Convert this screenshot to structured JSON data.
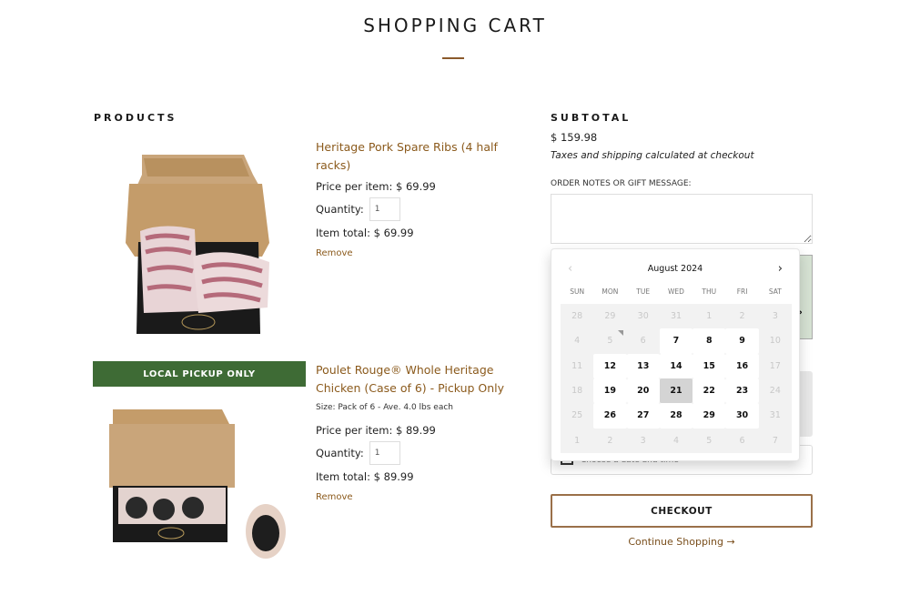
{
  "page": {
    "title": "SHOPPING CART"
  },
  "products_section": {
    "heading": "PRODUCTS",
    "items": [
      {
        "name": "Heritage Pork Spare Ribs (4 half racks)",
        "price_label": "Price per item: $ 69.99",
        "quantity_label": "Quantity:",
        "quantity": "1",
        "total_label": "Item total: $ 69.99",
        "remove_label": "Remove",
        "image": "pork-spare-ribs-box"
      },
      {
        "badge": "LOCAL PICKUP ONLY",
        "name": "Poulet Rouge® Whole Heritage Chicken (Case of 6) - Pickup Only",
        "variant": "Size: Pack of 6 - Ave. 4.0 lbs each",
        "price_label": "Price per item: $ 89.99",
        "quantity_label": "Quantity:",
        "quantity": "1",
        "total_label": "Item total: $ 89.99",
        "remove_label": "Remove",
        "image": "whole-chicken-case"
      }
    ]
  },
  "summary": {
    "heading": "SUBTOTAL",
    "subtotal": "$ 159.98",
    "tax_note": "Taxes and shipping calculated at checkout",
    "notes_label": "ORDER NOTES OR GIFT MESSAGE:",
    "notes_value": "",
    "date_field_text": "Choose a date and time",
    "checkout_label": "CHECKOUT",
    "continue_label": "Continue Shopping →"
  },
  "datepicker": {
    "month_label": "August 2024",
    "prev_icon": "‹",
    "next_icon": "›",
    "weekdays": [
      "SUN",
      "MON",
      "TUE",
      "WED",
      "THU",
      "FRI",
      "SAT"
    ],
    "weeks": [
      [
        "28",
        "29",
        "30",
        "31",
        "1",
        "2",
        "3"
      ],
      [
        "4",
        "5",
        "6",
        "7",
        "8",
        "9",
        "10"
      ],
      [
        "11",
        "12",
        "13",
        "14",
        "15",
        "16",
        "17"
      ],
      [
        "18",
        "19",
        "20",
        "21",
        "22",
        "23",
        "24"
      ],
      [
        "25",
        "26",
        "27",
        "28",
        "29",
        "30",
        "31"
      ],
      [
        "1",
        "2",
        "3",
        "4",
        "5",
        "6",
        "7"
      ]
    ],
    "available_days": [
      "7",
      "8",
      "9",
      "12",
      "13",
      "14",
      "15",
      "16",
      "19",
      "20",
      "21",
      "22",
      "23",
      "26",
      "27",
      "28",
      "29",
      "30"
    ],
    "selected_day": "21",
    "today_day": "5"
  },
  "colors": {
    "accent": "#8b5a1c",
    "pickup_green": "#3e6b35",
    "checkout_border": "#9a7049"
  }
}
